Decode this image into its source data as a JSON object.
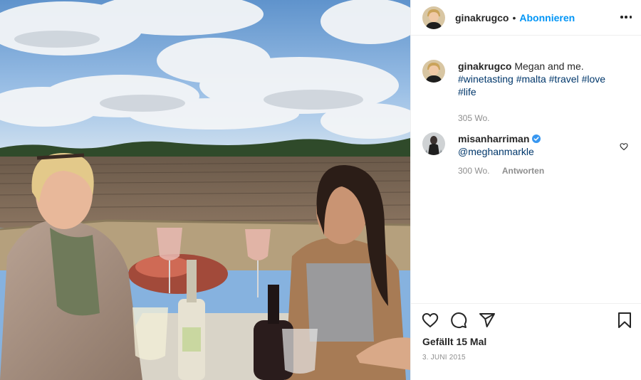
{
  "header": {
    "username": "ginakrugco",
    "separator": "•",
    "follow_label": "Abonnieren",
    "avatar_icon": "profile-photo-icon",
    "more_icon": "more-options-icon"
  },
  "caption": {
    "username": "ginakrugco",
    "text": "Megan and me.",
    "hashtags": [
      "#winetasting",
      "#malta",
      "#travel",
      "#love",
      "#life"
    ],
    "age": "305 Wo."
  },
  "comments": [
    {
      "username": "misanharriman",
      "verified": true,
      "text": "@meghanmarkle",
      "age": "300 Wo.",
      "reply_label": "Antworten"
    }
  ],
  "actions": {
    "like_icon": "heart-icon",
    "comment_icon": "comment-icon",
    "share_icon": "send-icon",
    "save_icon": "bookmark-icon",
    "likes_label": "Gefällt 15 Mal",
    "date": "3. JUNI 2015"
  },
  "colors": {
    "link_blue": "#0095f6",
    "hashtag_blue": "#00376b",
    "meta_gray": "#8e8e8e",
    "text": "#262626",
    "verified_blue": "#3897f0"
  }
}
